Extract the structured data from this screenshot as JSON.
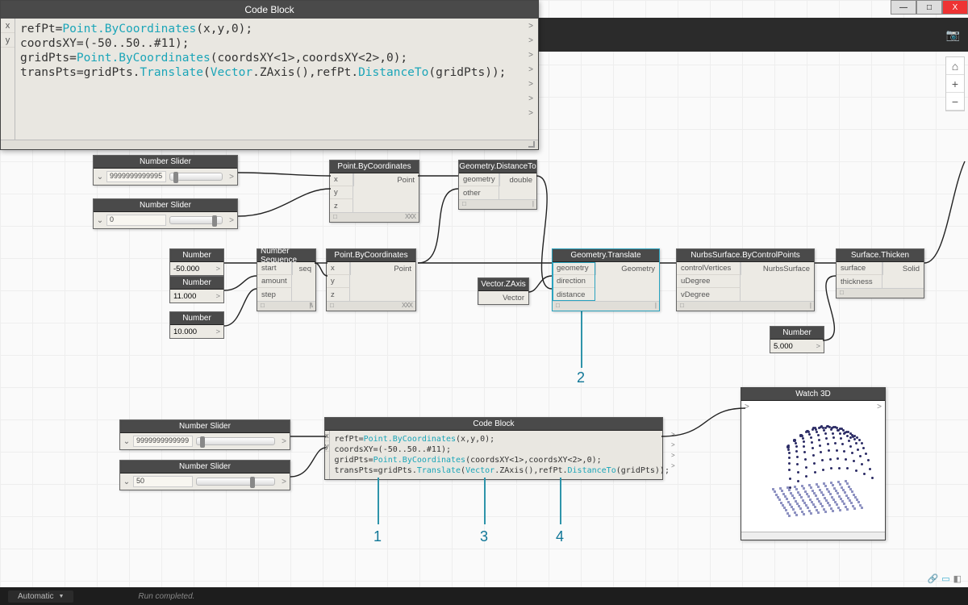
{
  "window": {
    "minimize": "—",
    "maximize": "□",
    "close": "X"
  },
  "topbar": {
    "camera": "📷"
  },
  "zoom": {
    "home": "⌂",
    "plus": "+",
    "minus": "−"
  },
  "status": {
    "mode": "Automatic",
    "message": "Run completed."
  },
  "big_code": {
    "title": "Code Block",
    "inputs": [
      "x",
      "y"
    ],
    "lines": [
      [
        {
          "t": "var",
          "s": "refPt="
        },
        {
          "t": "fn",
          "s": "Point.ByCoordinates"
        },
        {
          "t": "var",
          "s": "(x,y,0);"
        }
      ],
      [
        {
          "t": "var",
          "s": "coordsXY=(-50..50..#11);"
        }
      ],
      [
        {
          "t": "var",
          "s": "gridPts="
        },
        {
          "t": "fn",
          "s": "Point.ByCoordinates"
        },
        {
          "t": "var",
          "s": "(coordsXY<1>,coordsXY<2>,0);"
        }
      ],
      [
        {
          "t": "var",
          "s": "transPts=gridPts."
        },
        {
          "t": "fn",
          "s": "Translate"
        },
        {
          "t": "var",
          "s": "("
        },
        {
          "t": "fn",
          "s": "Vector"
        },
        {
          "t": "var",
          "s": ".ZAxis(),refPt."
        },
        {
          "t": "fn",
          "s": "DistanceTo"
        },
        {
          "t": "var",
          "s": "(gridPts));"
        }
      ]
    ]
  },
  "big_annos": {
    "a1": "1",
    "a3": "3",
    "a4": "4",
    "a2": "2"
  },
  "mini_code": {
    "title": "Code Block",
    "inputs": [
      "x",
      "y"
    ],
    "lines": [
      [
        {
          "t": "var",
          "s": "refPt="
        },
        {
          "t": "fn",
          "s": "Point.ByCoordinates"
        },
        {
          "t": "var",
          "s": "(x,y,0);"
        }
      ],
      [
        {
          "t": "var",
          "s": "coordsXY=(-50..50..#11);"
        }
      ],
      [
        {
          "t": "var",
          "s": "gridPts="
        },
        {
          "t": "fn",
          "s": "Point.ByCoordinates"
        },
        {
          "t": "var",
          "s": "(coordsXY<1>,coordsXY<2>,0);"
        }
      ],
      [
        {
          "t": "var",
          "s": "transPts=gridPts."
        },
        {
          "t": "fn",
          "s": "Translate"
        },
        {
          "t": "var",
          "s": "("
        },
        {
          "t": "fn",
          "s": "Vector"
        },
        {
          "t": "var",
          "s": ".ZAxis(),refPt."
        },
        {
          "t": "fn",
          "s": "DistanceTo"
        },
        {
          "t": "var",
          "s": "(gridPts));"
        }
      ]
    ]
  },
  "mini_annos": {
    "a1": "1",
    "a3": "3",
    "a4": "4"
  },
  "sliders": {
    "s1": {
      "title": "Number Slider",
      "value": "9999999999995"
    },
    "s2": {
      "title": "Number Slider",
      "value": "0"
    },
    "s3": {
      "title": "Number Slider",
      "value": "9999999999999"
    },
    "s4": {
      "title": "Number Slider",
      "value": "50"
    }
  },
  "numbers": {
    "n1": {
      "title": "Number",
      "value": "-50.000"
    },
    "n2": {
      "title": "Number",
      "value": "11.000"
    },
    "n3": {
      "title": "Number",
      "value": "10.000"
    },
    "n4": {
      "title": "Number",
      "value": "5.000"
    }
  },
  "nodes": {
    "seq": {
      "title": "Number Sequence",
      "in": [
        "start",
        "amount",
        "step"
      ],
      "out": [
        "seq"
      ],
      "lacing": "|\\\\"
    },
    "pbc1": {
      "title": "Point.ByCoordinates",
      "in": [
        "x",
        "y",
        "z"
      ],
      "out": [
        "Point"
      ],
      "lacing": "XXX"
    },
    "pbc2": {
      "title": "Point.ByCoordinates",
      "in": [
        "x",
        "y",
        "z"
      ],
      "out": [
        "Point"
      ],
      "lacing": "XXX"
    },
    "dist": {
      "title": "Geometry.DistanceTo",
      "in": [
        "geometry",
        "other"
      ],
      "out": [
        "double"
      ],
      "lacing": "|"
    },
    "zaxis": {
      "title": "Vector.ZAxis",
      "in": [],
      "out": [
        "Vector"
      ],
      "lacing": ""
    },
    "trans": {
      "title": "Geometry.Translate",
      "in": [
        "geometry",
        "direction",
        "distance"
      ],
      "out": [
        "Geometry"
      ],
      "lacing": "|"
    },
    "nurbs": {
      "title": "NurbsSurface.ByControlPoints",
      "in": [
        "controlVertices",
        "uDegree",
        "vDegree"
      ],
      "out": [
        "NurbsSurface"
      ],
      "lacing": "|"
    },
    "thick": {
      "title": "Surface.Thicken",
      "in": [
        "surface",
        "thickness"
      ],
      "out": [
        "Solid"
      ],
      "lacing": ""
    }
  },
  "watch": {
    "title": "Watch 3D"
  }
}
